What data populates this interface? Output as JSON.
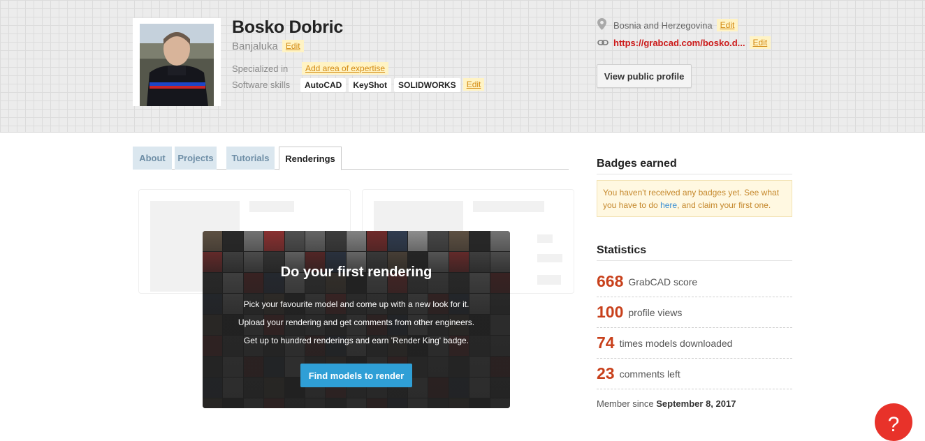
{
  "profile": {
    "name": "Bosko Dobric",
    "city": "Banjaluka",
    "edit_label": "Edit",
    "specialized_label": "Specialized in",
    "add_expertise": "Add area of expertise",
    "software_label": "Software skills",
    "skills": [
      "AutoCAD",
      "KeyShot",
      "SOLIDWORKS"
    ],
    "country": "Bosnia and Herzegovina",
    "url": "https://grabcad.com/bosko.d...",
    "view_public": "View public profile"
  },
  "tabs": [
    {
      "label": "About",
      "active": false
    },
    {
      "label": "Projects",
      "active": false
    },
    {
      "label": "Tutorials",
      "active": false
    },
    {
      "label": "Renderings",
      "active": true
    }
  ],
  "promo": {
    "title": "Do your first rendering",
    "lines": [
      "Pick your favourite model and come up with a new look for it.",
      "Upload your rendering and get comments from other engineers.",
      "Get up to hundred renderings and earn 'Render King' badge."
    ],
    "button": "Find models to render"
  },
  "badges": {
    "title": "Badges earned",
    "text_before": "You haven't received any badges yet. See what you have to do ",
    "link": "here",
    "text_after": ", and claim your first one."
  },
  "statistics": {
    "title": "Statistics",
    "rows": [
      {
        "value": "668",
        "label": "GrabCAD score"
      },
      {
        "value": "100",
        "label": "profile views"
      },
      {
        "value": "74",
        "label": "times models downloaded"
      },
      {
        "value": "23",
        "label": "comments left"
      }
    ],
    "member_label": "Member since",
    "member_date": "September 8, 2017"
  },
  "colors": {
    "accent_red": "#c8401b",
    "link_red": "#cc1a1a",
    "button_blue": "#2f9fd6",
    "tab_inactive": "#dbe7ef",
    "edit_bg": "#fff3c4",
    "help_red": "#e8322a"
  },
  "icons": {
    "location": "map-pin-icon",
    "link": "chain-link-icon",
    "help": "question-mark-icon"
  }
}
